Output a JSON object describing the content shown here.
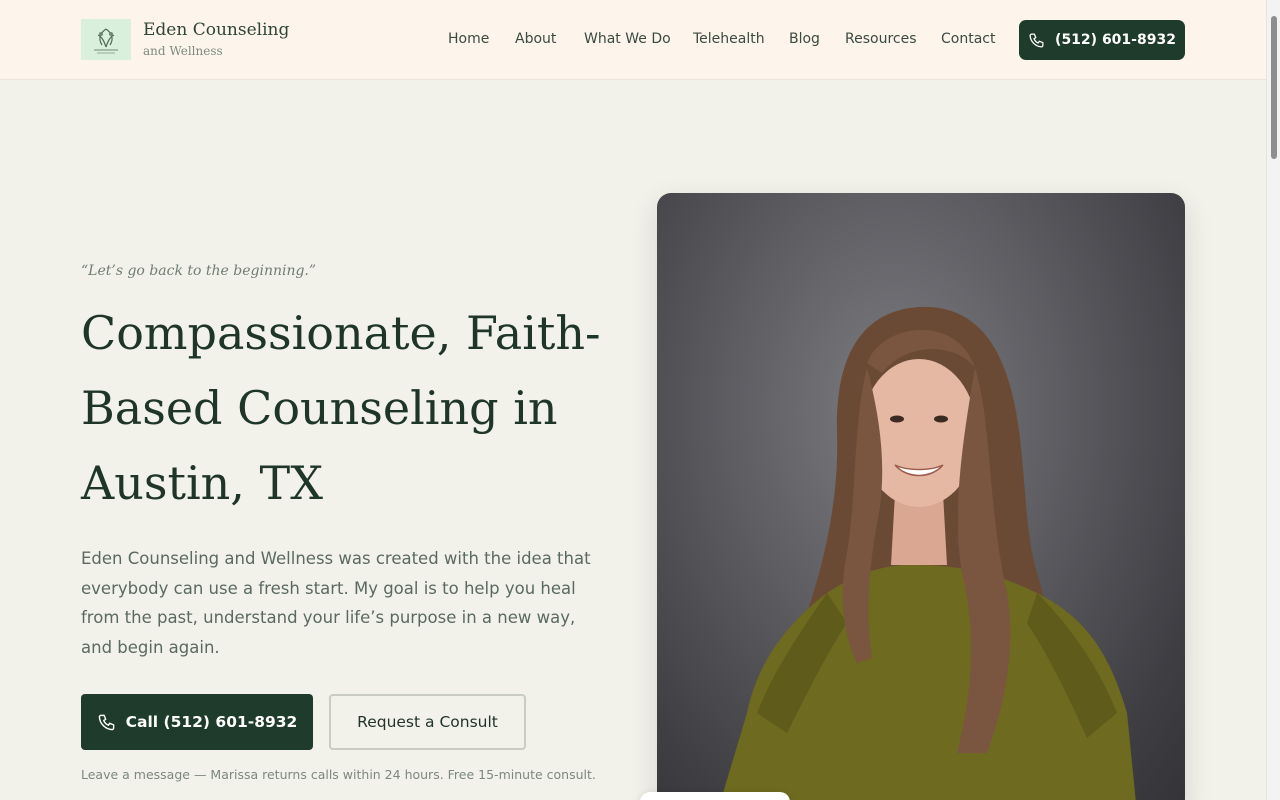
{
  "brand": {
    "name": "Eden Counseling",
    "sub": "and Wellness"
  },
  "nav": [
    "Home",
    "About",
    "What We Do",
    "Telehealth",
    "Blog",
    "Resources",
    "Contact"
  ],
  "header_phone": "(512) 601-8932",
  "hero": {
    "quote": "“Let’s go back to the beginning.”",
    "headline_lines": [
      "Compassionate, Faith-",
      "Based Counseling in",
      "Austin, TX"
    ],
    "lede": "Eden Counseling and Wellness was created with the idea that everybody can use a fresh start. My goal is to help you heal from the past, understand your life’s purpose in a new way, and begin again.",
    "call_label": "Call (512) 601-8932",
    "consult_label": "Request a Consult",
    "note": "Leave a message — Marissa returns calls within 24 hours. Free 15-minute consult."
  },
  "icons": {
    "phone": "phone-icon",
    "logo": "leaf-logo-icon",
    "portrait": "therapist-portrait"
  },
  "colors": {
    "accent": "#1f3b2b",
    "header_bg": "#fdf5ec",
    "page_bg": "#f3f2ea"
  }
}
